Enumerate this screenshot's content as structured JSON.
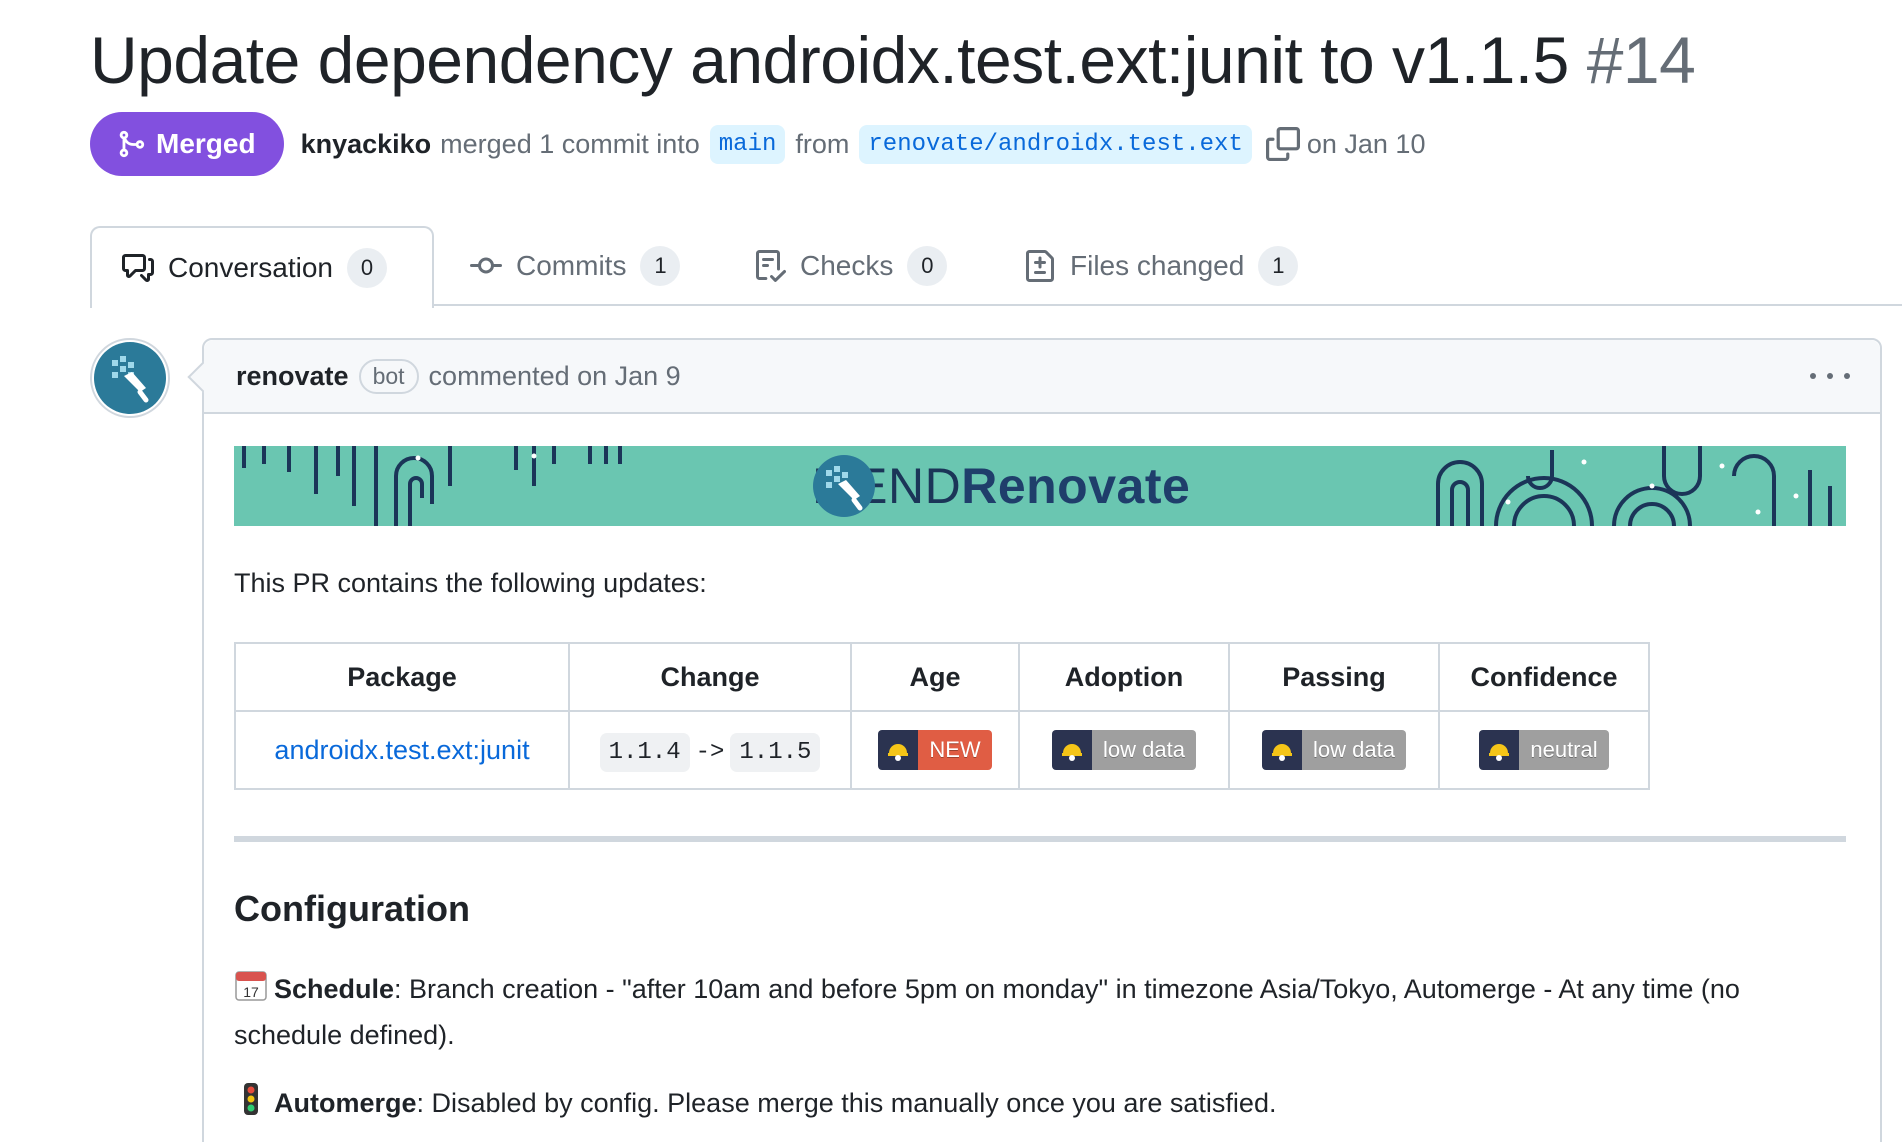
{
  "pr": {
    "title": "Update dependency androidx.test.ext:junit to v1.1.5",
    "number": "#14",
    "state": "Merged",
    "author": "knyackiko",
    "action_text": "merged 1 commit into",
    "base_branch": "main",
    "from_text": "from",
    "head_branch": "renovate/androidx.test.ext",
    "date_text": "on Jan 10"
  },
  "tabs": [
    {
      "label": "Conversation",
      "count": "0",
      "icon": "comment-discussion-icon",
      "active": true
    },
    {
      "label": "Commits",
      "count": "1",
      "icon": "git-commit-icon",
      "active": false
    },
    {
      "label": "Checks",
      "count": "0",
      "icon": "checklist-icon",
      "active": false
    },
    {
      "label": "Files changed",
      "count": "1",
      "icon": "file-diff-icon",
      "active": false
    }
  ],
  "comment": {
    "author": "renovate",
    "author_label": "bot",
    "meta": "commented on Jan 9",
    "banner": {
      "brand_left": "MEND",
      "brand_right": "Renovate"
    },
    "intro": "This PR contains the following updates:",
    "table": {
      "headers": [
        "Package",
        "Change",
        "Age",
        "Adoption",
        "Passing",
        "Confidence"
      ],
      "row": {
        "package": "androidx.test.ext:junit",
        "from_version": "1.1.4",
        "arrow": "->",
        "to_version": "1.1.5",
        "age": "NEW",
        "adoption": "low data",
        "passing": "low data",
        "confidence": "neutral"
      }
    },
    "config_heading": "Configuration",
    "schedule_label": "Schedule",
    "schedule_text": ": Branch creation - \"after 10am and before 5pm on monday\" in timezone Asia/Tokyo, Automerge - At any time (no schedule defined).",
    "automerge_label": "Automerge",
    "automerge_text": ": Disabled by config. Please merge this manually once you are satisfied."
  },
  "colors": {
    "merged": "#8250df",
    "link": "#0969da",
    "banner": "#6ac6b1",
    "badge_new": "#e05d44",
    "badge_gray": "#9f9f9f"
  }
}
